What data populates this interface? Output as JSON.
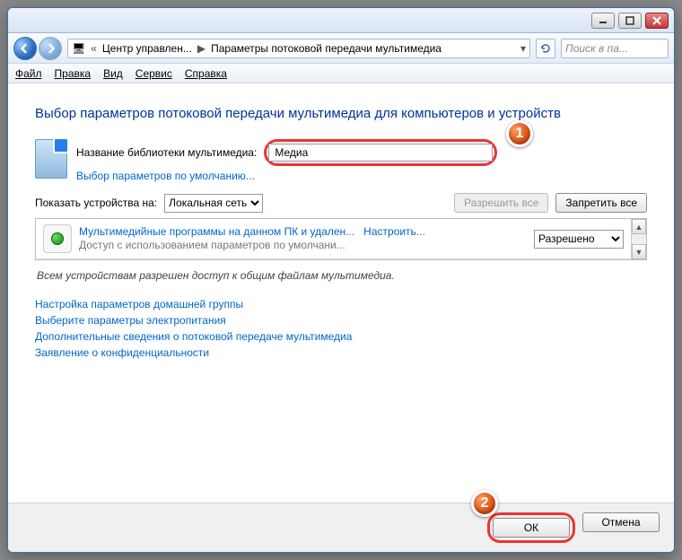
{
  "title_controls": {
    "minimize": "−",
    "maximize": "□",
    "close": "×"
  },
  "breadcrumb": {
    "prefix": "«",
    "item1": "Центр управлен...",
    "item2": "Параметры потоковой передачи мультимедиа"
  },
  "search_placeholder": "Поиск в па...",
  "menus": [
    "Файл",
    "Правка",
    "Вид",
    "Сервис",
    "Справка"
  ],
  "heading": "Выбор параметров потоковой передачи мультимедиа для компьютеров и устройств",
  "library_label": "Название библиотеки мультимедиа:",
  "library_value": "Медиа",
  "defaults_link": "Выбор параметров по умолчанию...",
  "show_label": "Показать устройства на:",
  "show_options": [
    "Локальная сеть"
  ],
  "allow_all": "Разрешить все",
  "block_all": "Запретить все",
  "device": {
    "name": "Мультимедийные программы на данном ПК и удален...",
    "configure": "Настроить...",
    "sub": "Доступ с использованием параметров по умолчани...",
    "state_options": [
      "Разрешено"
    ]
  },
  "status": "Всем устройствам разрешен доступ к общим файлам мультимедиа.",
  "links": [
    "Настройка параметров домашней группы",
    "Выберите параметры электропитания",
    "Дополнительные сведения о потоковой передаче мультимедиа",
    "Заявление о конфиденциальности"
  ],
  "ok": "ОК",
  "cancel": "Отмена",
  "callouts": {
    "one": "1",
    "two": "2"
  }
}
